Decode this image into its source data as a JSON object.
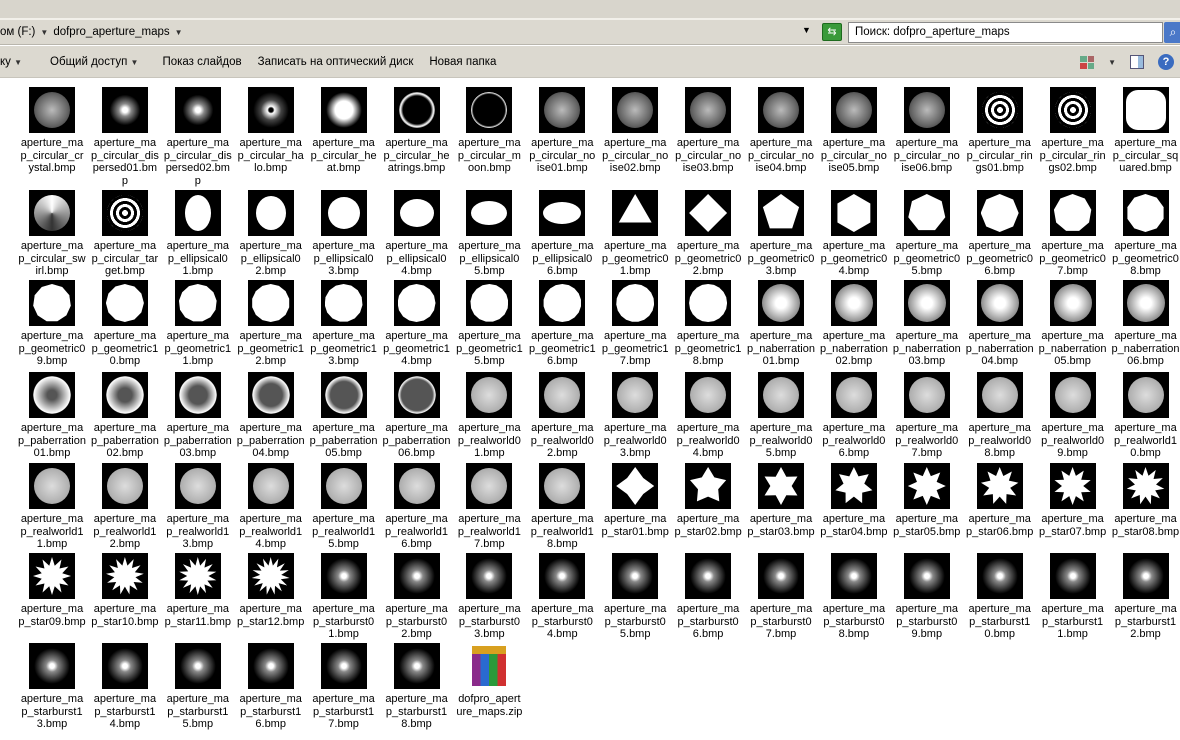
{
  "address": {
    "segments": [
      "ом (F:)",
      "dofpro_aperture_maps"
    ]
  },
  "search": {
    "placeholder": "Поиск: dofpro_aperture_maps"
  },
  "toolbar": {
    "items": [
      "ку",
      "Общий доступ",
      "Показ слайдов",
      "Записать на оптический диск",
      "Новая папка"
    ]
  },
  "files": {
    "items": [
      "aperture_map_circular_crystal.bmp",
      "aperture_map_circular_dispersed01.bmp",
      "aperture_map_circular_dispersed02.bmp",
      "aperture_map_circular_halo.bmp",
      "aperture_map_circular_heat.bmp",
      "aperture_map_circular_heatrings.bmp",
      "aperture_map_circular_moon.bmp",
      "aperture_map_circular_noise01.bmp",
      "aperture_map_circular_noise02.bmp",
      "aperture_map_circular_noise03.bmp",
      "aperture_map_circular_noise04.bmp",
      "aperture_map_circular_noise05.bmp",
      "aperture_map_circular_noise06.bmp",
      "aperture_map_circular_rings01.bmp",
      "aperture_map_circular_rings02.bmp",
      "aperture_map_circular_squared.bmp",
      "aperture_map_circular_swirl.bmp",
      "aperture_map_circular_target.bmp",
      "aperture_map_ellipsical01.bmp",
      "aperture_map_ellipsical02.bmp",
      "aperture_map_ellipsical03.bmp",
      "aperture_map_ellipsical04.bmp",
      "aperture_map_ellipsical05.bmp",
      "aperture_map_ellipsical06.bmp",
      "aperture_map_geometric01.bmp",
      "aperture_map_geometric02.bmp",
      "aperture_map_geometric03.bmp",
      "aperture_map_geometric04.bmp",
      "aperture_map_geometric05.bmp",
      "aperture_map_geometric06.bmp",
      "aperture_map_geometric07.bmp",
      "aperture_map_geometric08.bmp",
      "aperture_map_geometric09.bmp",
      "aperture_map_geometric10.bmp",
      "aperture_map_geometric11.bmp",
      "aperture_map_geometric12.bmp",
      "aperture_map_geometric13.bmp",
      "aperture_map_geometric14.bmp",
      "aperture_map_geometric15.bmp",
      "aperture_map_geometric16.bmp",
      "aperture_map_geometric17.bmp",
      "aperture_map_geometric18.bmp",
      "aperture_map_naberration01.bmp",
      "aperture_map_naberration02.bmp",
      "aperture_map_naberration03.bmp",
      "aperture_map_naberration04.bmp",
      "aperture_map_naberration05.bmp",
      "aperture_map_naberration06.bmp",
      "aperture_map_paberration01.bmp",
      "aperture_map_paberration02.bmp",
      "aperture_map_paberration03.bmp",
      "aperture_map_paberration04.bmp",
      "aperture_map_paberration05.bmp",
      "aperture_map_paberration06.bmp",
      "aperture_map_realworld01.bmp",
      "aperture_map_realworld02.bmp",
      "aperture_map_realworld03.bmp",
      "aperture_map_realworld04.bmp",
      "aperture_map_realworld05.bmp",
      "aperture_map_realworld06.bmp",
      "aperture_map_realworld07.bmp",
      "aperture_map_realworld08.bmp",
      "aperture_map_realworld09.bmp",
      "aperture_map_realworld10.bmp",
      "aperture_map_realworld11.bmp",
      "aperture_map_realworld12.bmp",
      "aperture_map_realworld13.bmp",
      "aperture_map_realworld14.bmp",
      "aperture_map_realworld15.bmp",
      "aperture_map_realworld16.bmp",
      "aperture_map_realworld17.bmp",
      "aperture_map_realworld18.bmp",
      "aperture_map_star01.bmp",
      "aperture_map_star02.bmp",
      "aperture_map_star03.bmp",
      "aperture_map_star04.bmp",
      "aperture_map_star05.bmp",
      "aperture_map_star06.bmp",
      "aperture_map_star07.bmp",
      "aperture_map_star08.bmp",
      "aperture_map_star09.bmp",
      "aperture_map_star10.bmp",
      "aperture_map_star11.bmp",
      "aperture_map_star12.bmp",
      "aperture_map_starburst01.bmp",
      "aperture_map_starburst02.bmp",
      "aperture_map_starburst03.bmp",
      "aperture_map_starburst04.bmp",
      "aperture_map_starburst05.bmp",
      "aperture_map_starburst06.bmp",
      "aperture_map_starburst07.bmp",
      "aperture_map_starburst08.bmp",
      "aperture_map_starburst09.bmp",
      "aperture_map_starburst10.bmp",
      "aperture_map_starburst11.bmp",
      "aperture_map_starburst12.bmp",
      "aperture_map_starburst13.bmp",
      "aperture_map_starburst14.bmp",
      "aperture_map_starburst15.bmp",
      "aperture_map_starburst16.bmp",
      "aperture_map_starburst17.bmp",
      "aperture_map_starburst18.bmp",
      "dofpro_aperture_maps.zip"
    ]
  }
}
